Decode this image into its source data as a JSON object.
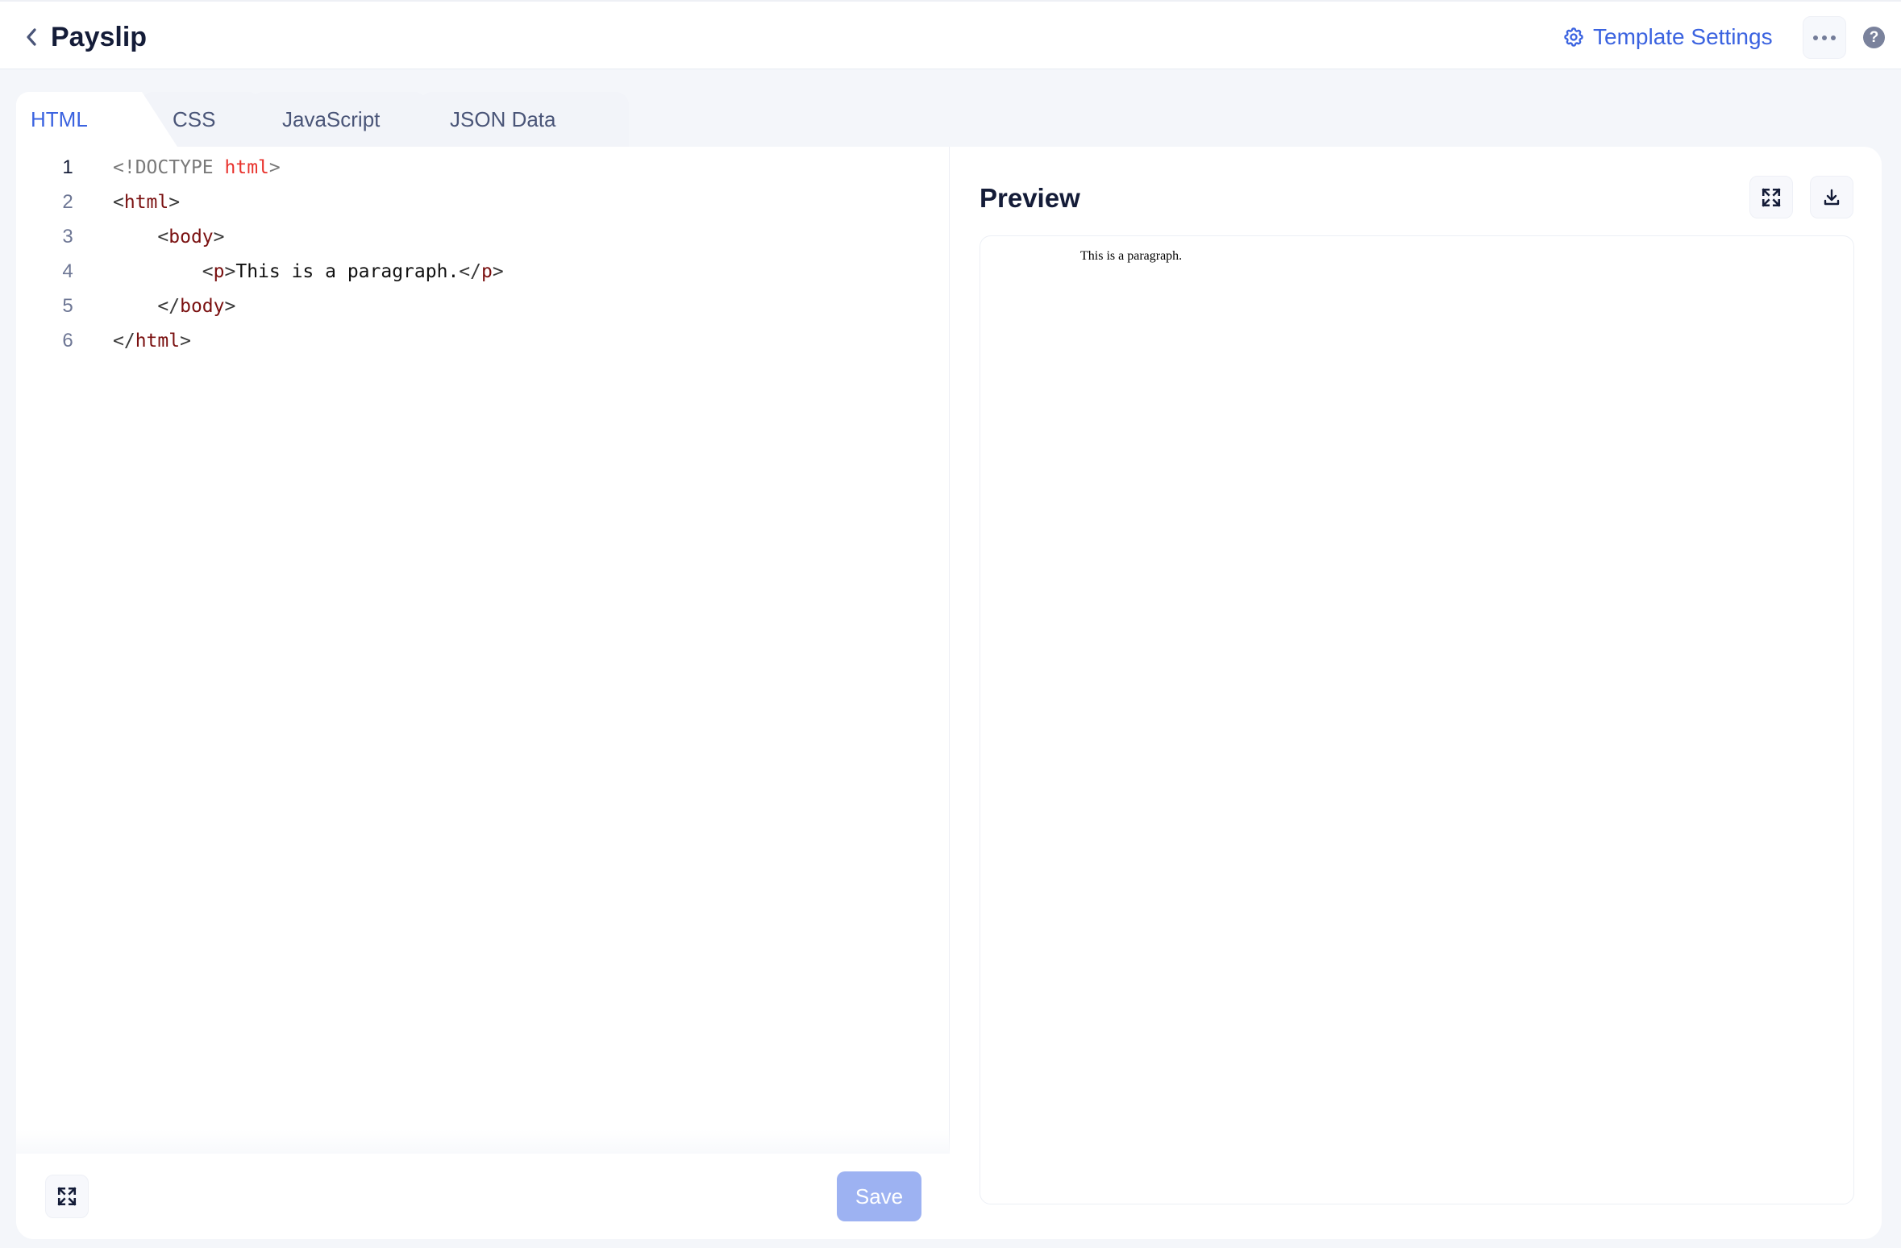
{
  "header": {
    "title": "Payslip",
    "back_icon": "chevron-left-icon",
    "template_settings_label": "Template Settings",
    "template_settings_icon": "gear-icon",
    "more_icon": "more-horizontal-icon",
    "help_icon": "question-circle-icon",
    "help_glyph": "?"
  },
  "tabs": [
    {
      "label": "HTML",
      "active": true
    },
    {
      "label": "CSS",
      "active": false
    },
    {
      "label": "JavaScript",
      "active": false
    },
    {
      "label": "JSON Data",
      "active": false
    }
  ],
  "editor": {
    "current_line": 1,
    "lines": [
      {
        "number": "1",
        "tokens": [
          {
            "t": "<!",
            "c": "c-punct"
          },
          {
            "t": "DOCTYPE",
            "c": "c-doctype"
          },
          {
            "t": " ",
            "c": "c-text"
          },
          {
            "t": "html",
            "c": "c-red"
          },
          {
            "t": ">",
            "c": "c-punct"
          }
        ]
      },
      {
        "number": "2",
        "tokens": [
          {
            "t": "<",
            "c": "c-bracket"
          },
          {
            "t": "html",
            "c": "c-tag"
          },
          {
            "t": ">",
            "c": "c-bracket"
          }
        ]
      },
      {
        "number": "3",
        "tokens": [
          {
            "t": "    <",
            "c": "c-bracket"
          },
          {
            "t": "body",
            "c": "c-tag"
          },
          {
            "t": ">",
            "c": "c-bracket"
          }
        ]
      },
      {
        "number": "4",
        "tokens": [
          {
            "t": "        <",
            "c": "c-bracket"
          },
          {
            "t": "p",
            "c": "c-tag"
          },
          {
            "t": ">",
            "c": "c-bracket"
          },
          {
            "t": "This is a paragraph.",
            "c": "c-text"
          },
          {
            "t": "</",
            "c": "c-bracket"
          },
          {
            "t": "p",
            "c": "c-tag"
          },
          {
            "t": ">",
            "c": "c-bracket"
          }
        ]
      },
      {
        "number": "5",
        "tokens": [
          {
            "t": "    </",
            "c": "c-bracket"
          },
          {
            "t": "body",
            "c": "c-tag"
          },
          {
            "t": ">",
            "c": "c-bracket"
          }
        ]
      },
      {
        "number": "6",
        "tokens": [
          {
            "t": "</",
            "c": "c-bracket"
          },
          {
            "t": "html",
            "c": "c-tag"
          },
          {
            "t": ">",
            "c": "c-bracket"
          }
        ]
      }
    ],
    "footer": {
      "expand_icon": "expand-icon",
      "save_label": "Save",
      "save_enabled": false
    }
  },
  "preview": {
    "title": "Preview",
    "expand_icon": "expand-icon",
    "download_icon": "download-icon",
    "rendered_text": "This is a paragraph."
  },
  "colors": {
    "accent": "#3b63e0",
    "save_disabled": "#9db2f2",
    "title": "#141c38",
    "background": "#f4f6fa"
  }
}
